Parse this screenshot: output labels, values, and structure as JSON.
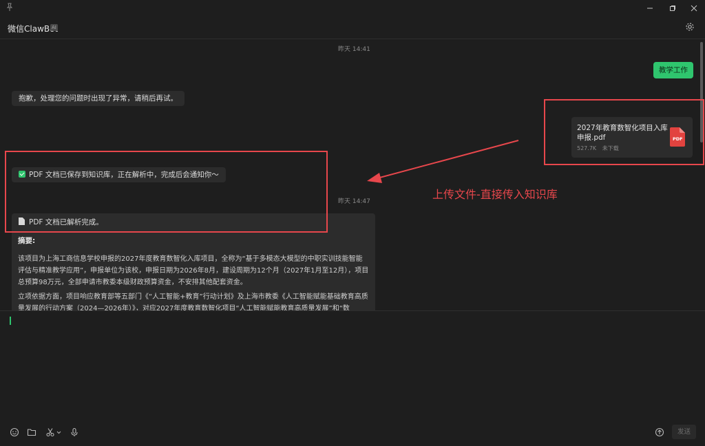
{
  "app": {
    "title": "微信ClawBot",
    "badge": "AI"
  },
  "chat": {
    "timestamps": [
      "昨天 14:41",
      "昨天 14:47"
    ],
    "user_message": "教学工作",
    "error_message": "抱歉，处理您的问题时出现了异常，请稍后再试。",
    "file": {
      "name": "2027年教育数智化项目入库申报.pdf",
      "size": "527.7K",
      "status": "未下载",
      "icon_label": "PDF"
    },
    "saved_message": "PDF 文档已保存到知识库，正在解析中，完成后会通知你～",
    "parsed_message": "PDF 文档已解析完成。",
    "summary": {
      "title": "摘要:",
      "paragraphs": [
        "该项目为上海工商信息学校申报的2027年度教育数智化入库项目，全称为“基于多模态大模型的中职实训技能智能评估与精准教学应用”，申报单位为该校，申报日期为2026年8月，建设周期为12个月（2027年1月至12月），项目总预算98万元，全部申请市教委本级财政预算资金，不安排其他配套资金。",
        "立项依据方面，项目响应教育部等五部门《“人工智能+教育”行动计划》及上海市教委《人工智能赋能基础教育高质量发展的行动方案（2024—2026年）》，对应2027年度教育数智化项目“人工智能赋能教育高质量发展”和“数"
      ]
    }
  },
  "annotation": {
    "text": "上传文件-直接传入知识库",
    "color": "#e8474c"
  },
  "composer": {
    "send_label": "发送"
  },
  "colors": {
    "accent": "#2fc56e",
    "background": "#1e1e1e",
    "bubble": "#2c2c2c"
  }
}
